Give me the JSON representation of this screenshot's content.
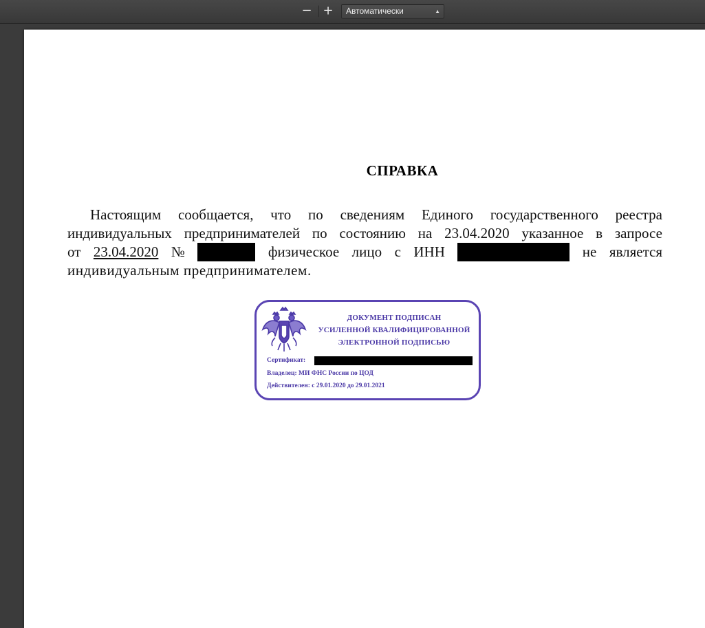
{
  "toolbar": {
    "zoom_out_label": "−",
    "zoom_in_label": "+",
    "zoom_value": "Автоматически"
  },
  "document": {
    "title": "СПРАВКА",
    "paragraph": {
      "line1": [
        "Настоящим",
        "сообщается,",
        "что",
        "по",
        "сведениям",
        "Единого",
        "государственного",
        "реестра"
      ],
      "line2": [
        "индивидуальных",
        "предпринимателей",
        "по",
        "состоянию",
        "на",
        "23.04.2020",
        "указанное",
        "в",
        "запросе"
      ],
      "line3": {
        "w1": "от",
        "date": "23.04.2020",
        "num_sign": "№",
        "w2": "физическое",
        "w3": "лицо",
        "w4": "с",
        "w5": "ИНН",
        "w6": "не",
        "w7": "является"
      },
      "line4": "индивидуальным предпринимателем."
    },
    "stamp": {
      "header": [
        "ДОКУМЕНТ ПОДПИСАН",
        "УСИЛЕННОЙ КВАЛИФИЦИРОВАННОЙ",
        "ЭЛЕКТРОННОЙ ПОДПИСЬЮ"
      ],
      "certificate_label": "Сертификат:",
      "owner": "Владелец: МИ ФНС России по ЦОД",
      "valid": "Действителен: с 29.01.2020 до 29.01.2021",
      "color": "#5a44b3",
      "emblem_icon": "double-headed-eagle-emblem"
    }
  }
}
